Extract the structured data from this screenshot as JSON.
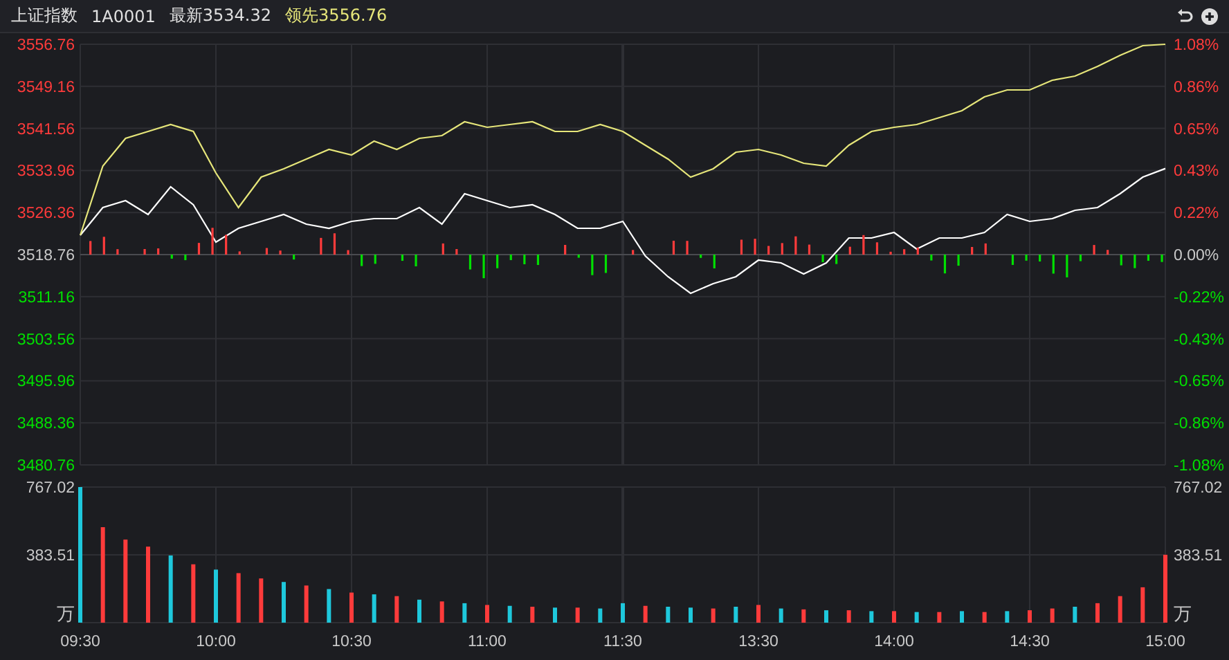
{
  "header": {
    "index_name": "上证指数",
    "code": "1A0001",
    "latest": "最新3534.32",
    "lead": "领先3556.76"
  },
  "price_chart": {
    "chart_data": {
      "type": "line",
      "grid": true,
      "categories": [
        null,
        null,
        null,
        null,
        null,
        null,
        null,
        null,
        null,
        null,
        null,
        null,
        null,
        null,
        null,
        null,
        null,
        null,
        null,
        null,
        null,
        null,
        null,
        null,
        null,
        null,
        null,
        null,
        null,
        null,
        null,
        null,
        null,
        null,
        null,
        null,
        null,
        null,
        null,
        null,
        null,
        null,
        null,
        null,
        null,
        null,
        null,
        null,
        null
      ],
      "ref_lines": [
        {
          "axis": "y",
          "value": 3518.76
        }
      ],
      "series": [
        {
          "color": "#ffffff",
          "values": [
            3522.26,
            3527.26,
            3528.51,
            3526.01,
            3531.01,
            3527.76,
            3521.01,
            3523.51,
            3524.76,
            3526.01,
            3524.26,
            3523.51,
            3524.76,
            3525.26,
            3525.26,
            3527.26,
            3524.26,
            3529.76,
            3528.51,
            3527.26,
            3527.76,
            3526.01,
            3523.51,
            3523.51,
            3524.76,
            3518.51,
            3514.76,
            3511.76,
            3513.51,
            3514.76,
            3517.76,
            3517.26,
            3515.26,
            3517.26,
            3521.76,
            3521.76,
            3522.76,
            3519.76,
            3521.76,
            3521.76,
            3522.76,
            3526.01,
            3524.76,
            3525.26,
            3526.76,
            3527.26,
            3529.76,
            3532.76,
            3534.32
          ]
        },
        {
          "color": "#e6e67a",
          "values": [
            3522.26,
            3534.76,
            3539.76,
            3541.01,
            3542.26,
            3541.01,
            3533.51,
            3527.26,
            3532.76,
            3534.26,
            3536.01,
            3537.76,
            3536.76,
            3539.26,
            3537.76,
            3539.76,
            3540.26,
            3542.76,
            3541.76,
            3542.26,
            3542.76,
            3541.01,
            3541.01,
            3542.26,
            3541.01,
            3538.51,
            3536.01,
            3532.76,
            3534.26,
            3537.26,
            3537.76,
            3536.76,
            3535.26,
            3534.76,
            3538.51,
            3541.01,
            3541.76,
            3542.26,
            3543.51,
            3544.76,
            3547.26,
            3548.51,
            3548.51,
            3550.26,
            3551.01,
            3552.76,
            3554.76,
            3556.51,
            3556.76
          ]
        }
      ],
      "ylim": [
        3480.76,
        3556.76
      ],
      "yticks": [
        {
          "value": 3556.76,
          "label": "3556.76"
        },
        {
          "value": 3549.16,
          "label": "3549.16"
        },
        {
          "value": 3541.56,
          "label": "3541.56"
        },
        {
          "value": 3533.96,
          "label": "3533.96"
        },
        {
          "value": 3526.36,
          "label": "3526.36"
        },
        {
          "value": 3518.76,
          "label": "3518.76"
        },
        {
          "value": 3511.16,
          "label": "3511.16"
        },
        {
          "value": 3503.56,
          "label": "3503.56"
        },
        {
          "value": 3495.96,
          "label": "3495.96"
        },
        {
          "value": 3488.36,
          "label": "3488.36"
        },
        {
          "value": 3480.76,
          "label": "3480.76"
        }
      ]
    },
    "right_yticks": [
      "1.08%",
      "0.86%",
      "0.65%",
      "0.43%",
      "0.22%",
      "0.00%",
      "-0.22%",
      "-0.43%",
      "-0.65%",
      "-0.86%",
      "-1.08%"
    ]
  },
  "volume_chart": {
    "chart_data": {
      "type": "bar",
      "stacked": true,
      "grid": true,
      "categories": [
        "09:30",
        null,
        null,
        null,
        null,
        null,
        "10:00",
        null,
        null,
        null,
        null,
        null,
        "10:30",
        null,
        null,
        null,
        null,
        null,
        "11:00",
        null,
        null,
        null,
        null,
        null,
        "11:30",
        null,
        null,
        null,
        null,
        null,
        "13:30",
        null,
        null,
        null,
        null,
        null,
        "14:00",
        null,
        null,
        null,
        null,
        null,
        "14:30",
        null,
        null,
        null,
        null,
        null,
        "15:00"
      ],
      "series": [
        {
          "color": "#ff3b3b",
          "values": [
            null,
            540,
            470,
            430,
            null,
            330,
            null,
            280,
            250,
            null,
            210,
            null,
            170,
            null,
            150,
            null,
            120,
            null,
            100,
            null,
            90,
            null,
            85,
            null,
            null,
            95,
            null,
            null,
            80,
            null,
            100,
            null,
            75,
            null,
            70,
            null,
            65,
            null,
            60,
            null,
            60,
            null,
            70,
            80,
            null,
            110,
            150,
            200,
            384
          ]
        },
        {
          "color": "#1ec8dc",
          "values": [
            767,
            null,
            null,
            null,
            380,
            null,
            300,
            null,
            null,
            230,
            null,
            190,
            null,
            160,
            null,
            130,
            null,
            110,
            null,
            95,
            null,
            85,
            null,
            80,
            110,
            null,
            90,
            85,
            null,
            90,
            null,
            80,
            null,
            70,
            null,
            65,
            null,
            60,
            null,
            65,
            null,
            65,
            null,
            null,
            90,
            null,
            null,
            null,
            null
          ]
        }
      ],
      "ylim": [
        0,
        767.02
      ],
      "yticks": [
        {
          "value": 767.02,
          "label": "767.02"
        },
        {
          "value": 383.51,
          "label": "383.51"
        },
        {
          "value": 0,
          "label": "万"
        }
      ]
    },
    "right_yticks": [
      "767.02",
      "383.51",
      "万"
    ]
  }
}
